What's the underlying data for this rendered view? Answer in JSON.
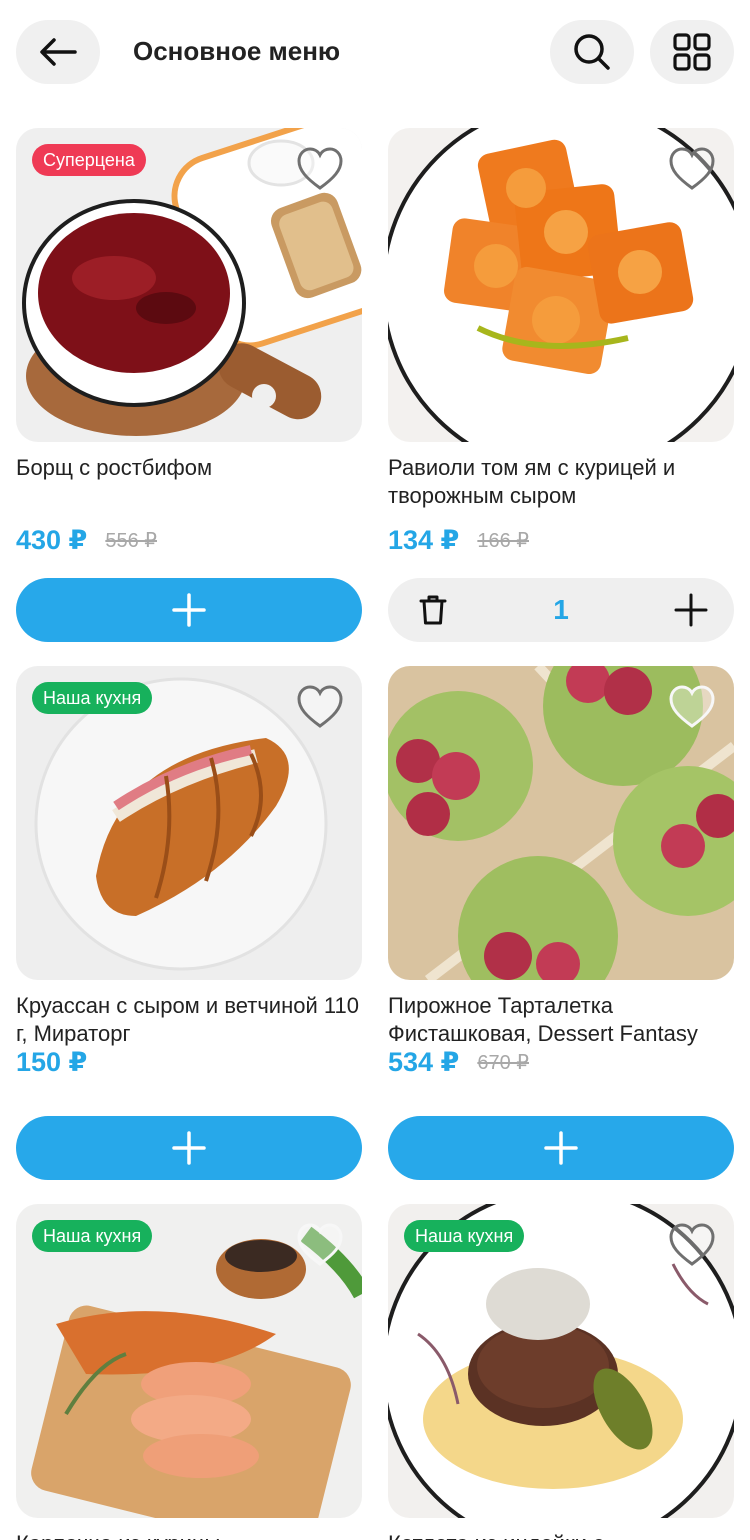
{
  "header": {
    "title": "Основное меню",
    "back_icon": "arrow-left-icon",
    "search_icon": "search-icon",
    "grid_icon": "grid-view-icon"
  },
  "colors": {
    "accent": "#27a8ea",
    "price": "#24a6e6",
    "badge_super": "#ef3a55",
    "badge_kitchen": "#17b15c"
  },
  "products": [
    {
      "name": "Борщ с ростбифом",
      "price": "430 ₽",
      "old_price": "556 ₽",
      "badge": "Суперцена",
      "in_cart": false
    },
    {
      "name": "Равиоли том ям с курицей и творожным сыром",
      "price": "134 ₽",
      "old_price": "166 ₽",
      "badge": "",
      "in_cart": true,
      "quantity": "1"
    },
    {
      "name": "Круассан с сыром и ветчиной 110 г, Мираторг",
      "price": "150 ₽",
      "old_price": "",
      "badge": "Наша кухня",
      "in_cart": false
    },
    {
      "name": "Пирожное Тарталетка Фисташковая, Dessert Fantasy",
      "price": "534 ₽",
      "old_price": "670 ₽",
      "badge": "",
      "in_cart": false
    },
    {
      "name": "Карпаччо из курицы",
      "price": "",
      "old_price": "",
      "badge": "Наша кухня",
      "in_cart": false
    },
    {
      "name": "Котлета из индейки с",
      "price": "",
      "old_price": "",
      "badge": "Наша кухня",
      "in_cart": false
    }
  ]
}
